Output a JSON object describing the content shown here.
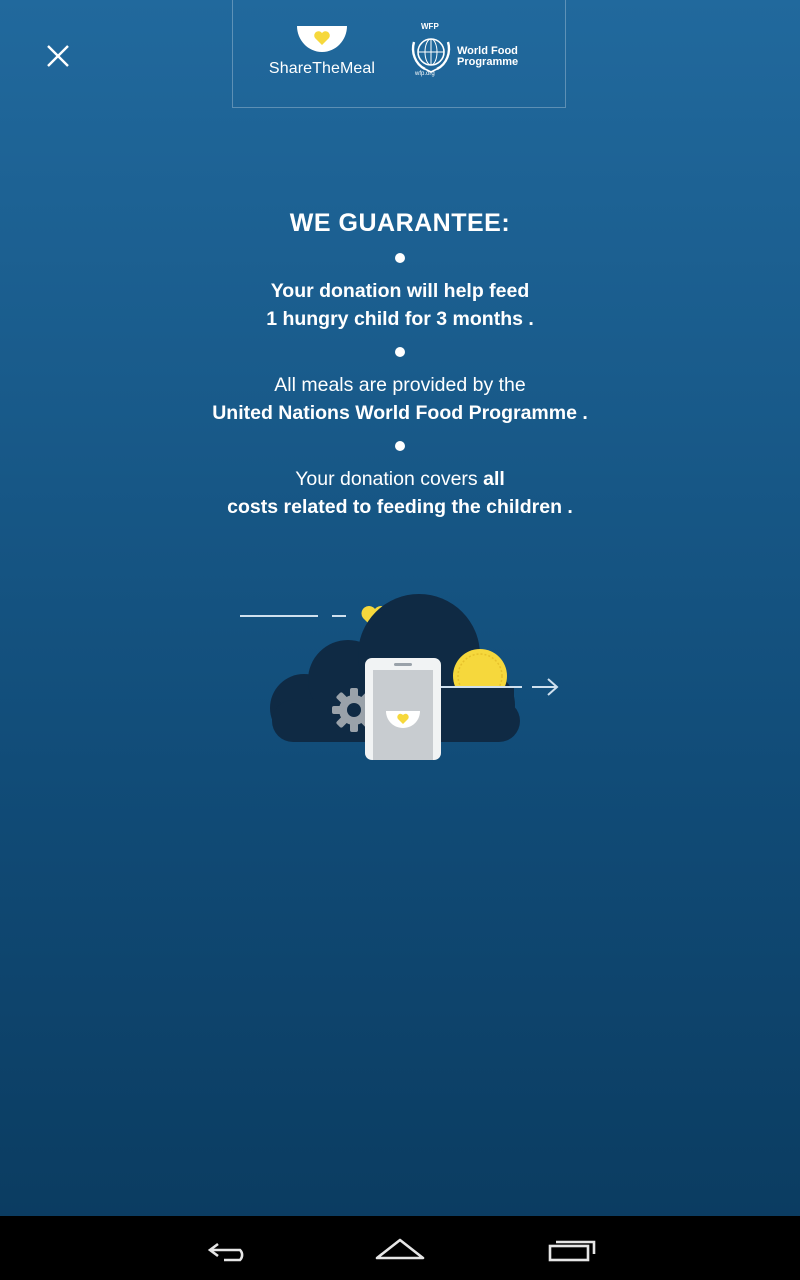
{
  "header": {
    "close_icon": "close-icon",
    "sharethemeal_logo_text": "ShareTheMeal",
    "wfp_logo": {
      "abbr": "WFP",
      "name_line1": "World Food",
      "name_line2": "Programme",
      "url": "wfp.org"
    }
  },
  "guarantee": {
    "title": "WE GUARANTEE:",
    "items": [
      {
        "line1": "Your donation will help feed",
        "line2": "1 hungry child for 3 months ."
      },
      {
        "line1": "All meals are provided by the",
        "line2": "United Nations World Food Programme ."
      },
      {
        "line1_regular": "Your donation covers ",
        "line1_bold": "all",
        "line2": "costs related to feeding the children ."
      }
    ]
  },
  "colors": {
    "background_top": "#21699d",
    "background_bottom": "#0a3a5e",
    "accent_yellow": "#f6d83c",
    "cloud": "#0f2a44"
  },
  "navbar": {
    "back_icon": "back-icon",
    "home_icon": "home-icon",
    "recents_icon": "recents-icon"
  }
}
